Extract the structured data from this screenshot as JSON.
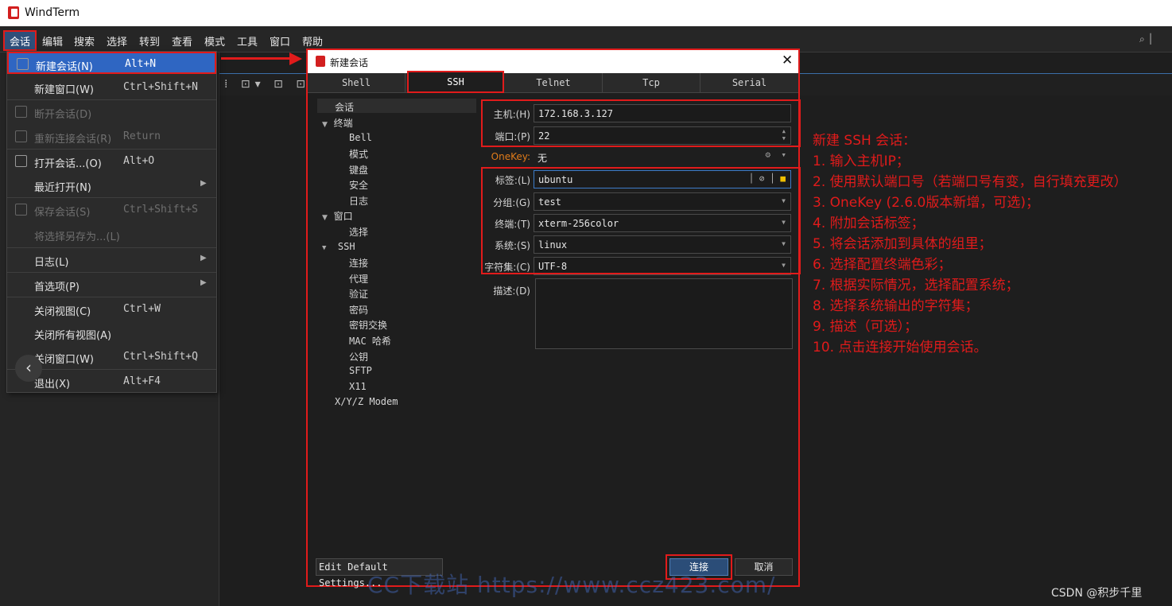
{
  "app": {
    "title": "WindTerm"
  },
  "menubar": {
    "items": [
      "会话",
      "编辑",
      "搜索",
      "选择",
      "转到",
      "查看",
      "模式",
      "工具",
      "窗口",
      "帮助"
    ],
    "right_icon": "search-icon"
  },
  "session_menu": {
    "items": [
      {
        "label": "新建会话(N)",
        "shortcut": "Alt+N",
        "icon": "new-session-icon",
        "enabled": true,
        "selected": true
      },
      {
        "label": "新建窗口(W)",
        "shortcut": "Ctrl+Shift+N",
        "enabled": true
      },
      {
        "label": "断开会话(D)",
        "shortcut": "",
        "icon": "disconnect-icon",
        "enabled": false
      },
      {
        "label": "重新连接会话(R)",
        "shortcut": "Return",
        "icon": "reconnect-icon",
        "enabled": false
      },
      {
        "label": "打开会话...(O)",
        "shortcut": "Alt+O",
        "icon": "open-session-icon",
        "enabled": true
      },
      {
        "label": "最近打开(N)",
        "shortcut": "",
        "submenu": true,
        "enabled": true
      },
      {
        "label": "保存会话(S)",
        "shortcut": "Ctrl+Shift+S",
        "icon": "save-icon",
        "enabled": false
      },
      {
        "label": "将选择另存为...(L)",
        "shortcut": "",
        "enabled": false
      },
      {
        "label": "日志(L)",
        "shortcut": "",
        "submenu": true,
        "enabled": true
      },
      {
        "label": "首选项(P)",
        "shortcut": "",
        "submenu": true,
        "enabled": true
      },
      {
        "label": "关闭视图(C)",
        "shortcut": "Ctrl+W",
        "enabled": true
      },
      {
        "label": "关闭所有视图(A)",
        "shortcut": "",
        "enabled": true
      },
      {
        "label": "关闭窗口(W)",
        "shortcut": "Ctrl+Shift+Q",
        "enabled": true
      },
      {
        "label": "退出(X)",
        "shortcut": "Alt+F4",
        "enabled": true
      }
    ]
  },
  "dialog": {
    "title": "新建会话",
    "tabs": [
      "Shell",
      "SSH",
      "Telnet",
      "Tcp",
      "Serial"
    ],
    "active_tab": "SSH",
    "tree": [
      "会话",
      "终端",
      "Bell",
      "模式",
      "键盘",
      "安全",
      "日志",
      "窗口",
      "选择",
      "SSH",
      "连接",
      "代理",
      "验证",
      "密码",
      "密钥交换",
      "MAC 哈希",
      "公钥",
      "SFTP",
      "X11",
      "X/Y/Z Modem"
    ],
    "fields": {
      "host": {
        "label": "主机:(H)",
        "value": "172.168.3.127"
      },
      "port": {
        "label": "端口:(P)",
        "value": "22"
      },
      "onekey": {
        "label": "OneKey:",
        "value": "无"
      },
      "tag": {
        "label": "标签:(L)",
        "value": "ubuntu"
      },
      "group": {
        "label": "分组:(G)",
        "value": "test"
      },
      "terminal": {
        "label": "终端:(T)",
        "value": "xterm-256color"
      },
      "system": {
        "label": "系统:(S)",
        "value": "linux"
      },
      "charset": {
        "label": "字符集:(C)",
        "value": "UTF-8"
      },
      "description": {
        "label": "描述:(D)",
        "value": ""
      }
    },
    "buttons": {
      "edit_defaults": "Edit Default Settings...",
      "connect": "连接",
      "cancel": "取消"
    }
  },
  "instructions": [
    "新建 SSH 会话：",
    "1. 输入主机IP；",
    "2. 使用默认端口号（若端口号有变，自行填充更改）",
    "3. OneKey (2.6.0版本新增，可选)；",
    "4. 附加会话标签；",
    "5. 将会话添加到具体的组里；",
    "6. 选择配置终端色彩；",
    "7. 根据实际情况，选择配置系统；",
    "8. 选择系统输出的字符集；",
    "9. 描述（可选）；",
    "10. 点击连接开始使用会话。"
  ],
  "watermark": "CC下载站 https://www.ccz423.com/",
  "credit": "CSDN @积步千里",
  "colors": {
    "annotation": "#e11b1b",
    "selection": "#2f66c2",
    "onekey_label": "#e07b1a"
  }
}
